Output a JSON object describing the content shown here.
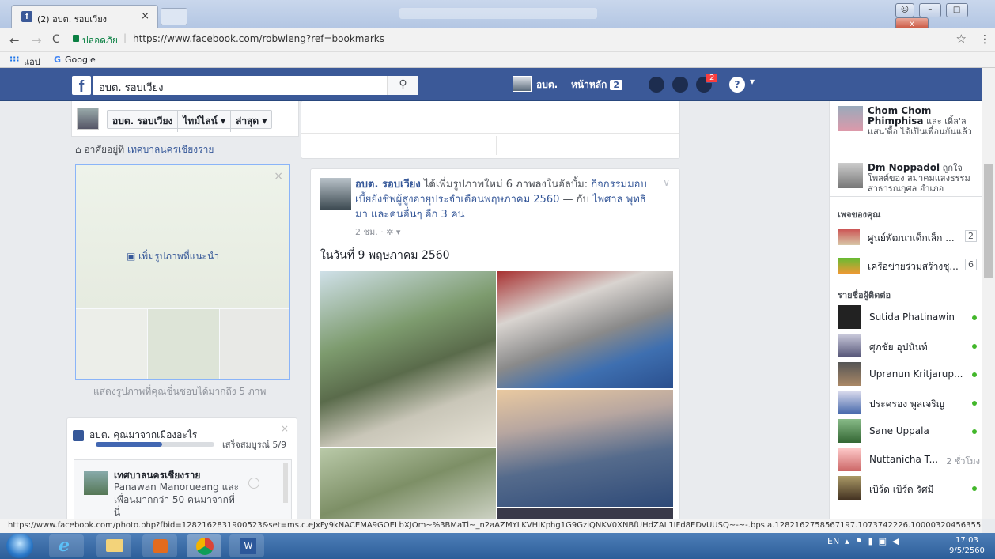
{
  "browser": {
    "tab_title": "(2) อบต. รอบเวียง",
    "tab_close": "×",
    "safe_label": "ปลอดภัย",
    "url": "https://www.facebook.com/robwieng?ref=bookmarks",
    "bookmarks": [
      "แอป",
      "Google"
    ],
    "status_url": "https://www.facebook.com/photo.php?fbid=1282162831900523&set=ms.c.eJxFy9kNACEMA9GOELbXJOm~%3BMaTl~_n2aAZMYLKVHIKphg1G9GziQNKV0XNBfUHdZAL1IFd8EDvUUSQ~-~-.bps.a.1282162758567197.1073742226.100003204563553&typ..."
  },
  "facebook": {
    "search_value": "อบต. รอบเวียง",
    "nav_profile": "อบต.",
    "nav_home": "หน้าหลัก",
    "nav_home_count": "2",
    "notif_count": "2"
  },
  "left": {
    "page_name": "อบต. รอบเวียง",
    "timeline_btn": "ไทม์ไลน์ ▾",
    "latest_btn": "ล่าสุด ▾",
    "lives_in_prefix": "อาศัยอยู่ที่",
    "lives_in_value": "เทศบาลนครเชียงราย",
    "add_photo": "เพิ่มรูปภาพที่แนะนำ",
    "photo_hint": "แสดงรูปภาพที่คุณชื่นชอบได้มากถึง 5 ภาพ",
    "city_question": "อบต. คุณมาจากเมืองอะไร",
    "progress_text": "เสร็จสมบูรณ์ 5/9",
    "progress_fraction": 0.56,
    "city_name": "เทศบาลนครเชียงราย",
    "city_sub": "Panawan Manorueang และเพื่อนมากกว่า 50 คนมาจากที่นี่"
  },
  "post": {
    "author": "อบต. รอบเวียง",
    "action": " ได้เพิ่มรูปภาพใหม่ 6 ภาพลงในอัลบั้ม: ",
    "album": "กิจกรรมมอบเบี้ยยังชีพผู้สูงอายุประจำเดือนพฤษภาคม 2560",
    "with": " — กับ ",
    "tagged": "ไพศาล พุทธิมา และคนอื่นๆ อีก 3 คน",
    "time": "2 ชม. · ✲ ▾",
    "text": "ในวันที่ 9 พฤษภาคม 2560"
  },
  "rail": {
    "ticker": [
      {
        "name": "Chom Chom Phimphisa",
        "text": "และ เดิ้ล'ล แสน'ดื้อ ได้เป็นเพื่อนกันแล้ว"
      },
      {
        "name": "Dm Noppadol",
        "text": "ถูกใจโพสต์ของ สมาคมแสงธรรมสาธารณกุศล อำเภอ"
      }
    ],
    "pages_header": "เพจของคุณ",
    "pages": [
      {
        "name": "ศูนย์พัฒนาเด็กเล็ก ...",
        "count": "2"
      },
      {
        "name": "เครือข่ายร่วมสร้างชุ...",
        "count": "6"
      }
    ],
    "contacts_header": "รายชื่อผู้ติดต่อ",
    "contacts": [
      {
        "name": "Sutida Phatinawin",
        "time": ""
      },
      {
        "name": "ศุภชัย อุปนันท์",
        "time": ""
      },
      {
        "name": "Upranun Kritjarup...",
        "time": ""
      },
      {
        "name": "ประครอง พูลเจริญ",
        "time": ""
      },
      {
        "name": "Sane Uppala",
        "time": ""
      },
      {
        "name": "Nuttanicha T...",
        "time": "2 ชั่วโมง"
      },
      {
        "name": "เบิร์ด เบิร์ด รัศมี",
        "time": ""
      }
    ]
  },
  "taskbar": {
    "lang": "EN",
    "time": "17:03",
    "date": "9/5/2560"
  },
  "colors": {
    "facebook_blue": "#3b5998",
    "link": "#365899",
    "online": "#42b72a"
  }
}
